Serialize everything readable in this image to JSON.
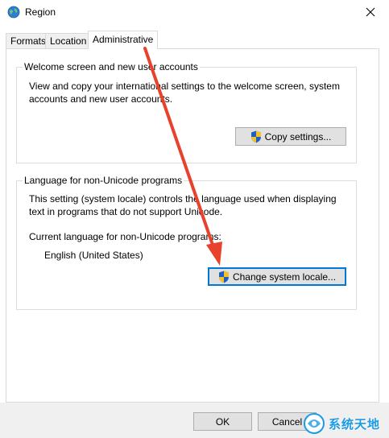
{
  "window": {
    "title": "Region",
    "icons": {
      "app": "globe-icon",
      "close": "close-icon"
    }
  },
  "tabs": [
    {
      "label": "Formats",
      "active": false
    },
    {
      "label": "Location",
      "active": false
    },
    {
      "label": "Administrative",
      "active": true
    }
  ],
  "welcome_group": {
    "title": "Welcome screen and new user accounts",
    "line1": "View and copy your international settings to the welcome screen, system",
    "line2": "accounts and new user accounts.",
    "button_label": "Copy settings..."
  },
  "locale_group": {
    "title": "Language for non-Unicode programs",
    "line1": "This setting (system locale) controls the language used when displaying",
    "line2": "text in programs that do not support Unicode.",
    "current_label": "Current language for non-Unicode programs:",
    "current_value": "English (United States)",
    "button_label": "Change system locale..."
  },
  "footer": {
    "ok_label": "OK",
    "cancel_label": "Cancel"
  },
  "watermark": {
    "text": "系统天地",
    "icon": "watermark-logo-icon"
  },
  "colors": {
    "annotation_arrow": "#e8412c",
    "focus_border": "#0078d7",
    "watermark": "#1a9be6"
  }
}
